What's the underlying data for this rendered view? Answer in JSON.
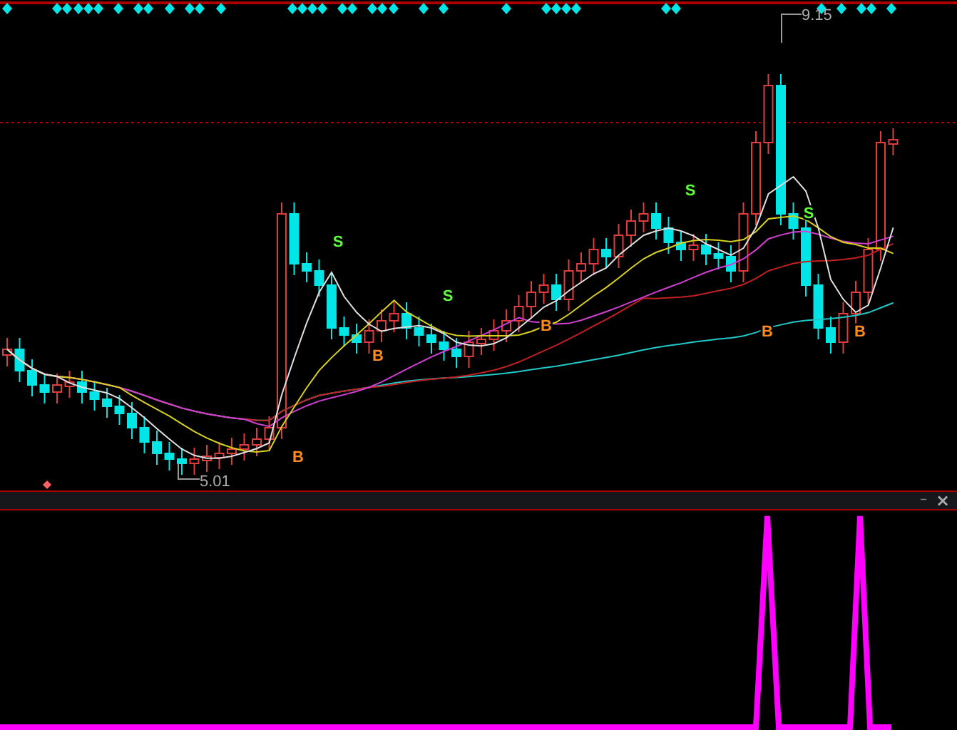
{
  "main_chart": {
    "high_label": "9.15",
    "low_label": "5.01",
    "signals": [
      {
        "kind": "buy",
        "text": "B"
      },
      {
        "kind": "sell",
        "text": "S"
      },
      {
        "kind": "buy",
        "text": "B"
      },
      {
        "kind": "sell",
        "text": "S"
      },
      {
        "kind": "buy",
        "text": "B"
      },
      {
        "kind": "sell",
        "text": "S"
      },
      {
        "kind": "buy",
        "text": "B"
      },
      {
        "kind": "sell",
        "text": "S"
      },
      {
        "kind": "buy",
        "text": "B"
      }
    ]
  },
  "indicator_panel": {
    "buttons": [
      {
        "kind": "minimize",
        "text": "–"
      },
      {
        "kind": "close",
        "text": "×"
      }
    ]
  }
}
